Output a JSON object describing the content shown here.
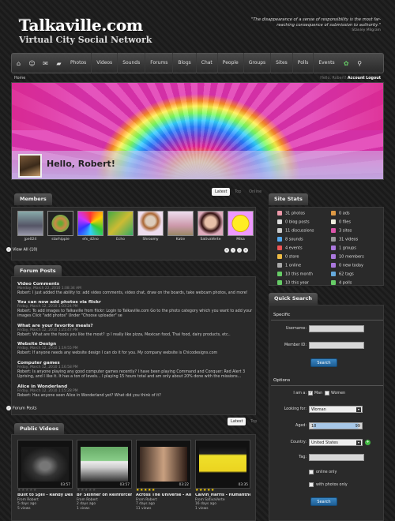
{
  "header": {
    "logo": "Talkaville.com",
    "tagline": "Virtual City Social Network",
    "quote": "\"The disappearance of a sense of responsibility is the most far-reaching consequence of submission to authority.\"",
    "quote_author": "Stanley Milgram"
  },
  "nav": {
    "items": [
      "Photos",
      "Videos",
      "Sounds",
      "Forums",
      "Blogs",
      "Chat",
      "People",
      "Groups",
      "Sites",
      "Polls",
      "Events"
    ]
  },
  "topbar": {
    "home": "Home",
    "hello": "Hello, Robert!",
    "account": "Account",
    "logout": "Logout"
  },
  "profile": {
    "greeting": "Hello, Robert!"
  },
  "tabs": {
    "latest": "Latest",
    "top": "Top",
    "online": "Online"
  },
  "members": {
    "title": "Members",
    "list": [
      "jpe024",
      "starhippie",
      "efx_d2no",
      "Echo",
      "Shroomy",
      "Katie",
      "SativaVerte",
      "Mika"
    ],
    "view_all": "View All (10)"
  },
  "forum": {
    "title": "Forum Posts",
    "posts": [
      {
        "title": "Video Comments",
        "date": "Monday, March 22, 2010 1:08:34 AM",
        "text": "Robert: I just added the ability to: add video comments, video chat, draw on the boards, take webcam photos, and more!"
      },
      {
        "title": "You can now add photos via flickr",
        "date": "Friday, March 12, 2010 1:03:24 PM",
        "text": "Robert: To add images to Talkaville from flickr: Login to Talkaville.com Go to the photo category which you want to add your images Click \"add photos\" Under \"Choose uploader\" se"
      },
      {
        "title": "What are your favorite meals?",
        "date": "Friday, March 12, 2010 1:21:47 PM",
        "text": "Robert: What are the foods you like the most? :p I really like pizza, Mexican food, Thai food, dairy products, etc.."
      },
      {
        "title": "Website Design",
        "date": "Friday, March 12, 2010 1:19:55 PM",
        "text": "Robert: If anyone needs any website design I can do it for you. My company website is Chicodesigns.com"
      },
      {
        "title": "Computer games",
        "date": "Friday, March 12, 2010 1:16:58 PM",
        "text": "Robert: Is anyone playing any good computer games recently? I have been playing Command and Conquer: Red Alert 3 Uprising, and I like it. It has a ton of levels... I playing 15 hours total and am only about 20% done with the missions..."
      },
      {
        "title": "Alice in Wonderland",
        "date": "Friday, March 12, 2010 1:15:28 PM",
        "text": "Robert: Has anyone seen Alice in Wonderland yet? What did you think of it?"
      }
    ],
    "footer": "Forum Posts"
  },
  "videos": {
    "title": "Public Videos",
    "tabs": {
      "latest": "Latest",
      "top": "Top"
    },
    "list": [
      {
        "title": "Built to Spill - Randy Describ",
        "from": "From Robert",
        "age": "5 days ago",
        "views": "5 views",
        "time": "03:57",
        "rated": false
      },
      {
        "title": "BF Skinner on Reinforceme",
        "from": "From Robert",
        "age": "2 days ago",
        "views": "1 views",
        "time": "03:57",
        "rated": false
      },
      {
        "title": "Across The Universe - All Y",
        "from": "From Robert",
        "age": "7 days ago",
        "views": "11 views",
        "time": "03:22",
        "rated": true
      },
      {
        "title": "Calvin_Harris - Humanthesi",
        "from": "From SativaVerte",
        "age": "16 days ago",
        "views": "1 views",
        "time": "03:35",
        "rated": true
      }
    ]
  },
  "site_stats": {
    "title": "Site Stats",
    "left": [
      "31 photos",
      "0 blog posts",
      "11 discussions",
      "8 sounds",
      "4 events",
      "0 store",
      "1 online",
      "10 this month",
      "10 this year"
    ],
    "right": [
      "0 ads",
      "0 files",
      "3 sites",
      "31 videos",
      "1 groups",
      "10 members",
      "0 new today",
      "62 tags",
      "4 polls"
    ]
  },
  "quick_search": {
    "title": "Quick Search",
    "specific": "Specific",
    "username_label": "Username:",
    "memberid_label": "Member ID:",
    "search_label": "Search",
    "options": "Options",
    "iam_label": "I am a:",
    "man": "Man",
    "woman": "Women",
    "lookingfor_label": "Looking for:",
    "lookingfor_value": "Woman",
    "aged_label": "Aged:",
    "age_min": "18",
    "age_max": "99",
    "country_label": "Country:",
    "country_value": "United States",
    "tag_label": "Tag:",
    "online_only": "online only",
    "with_photos": "with photos only"
  }
}
